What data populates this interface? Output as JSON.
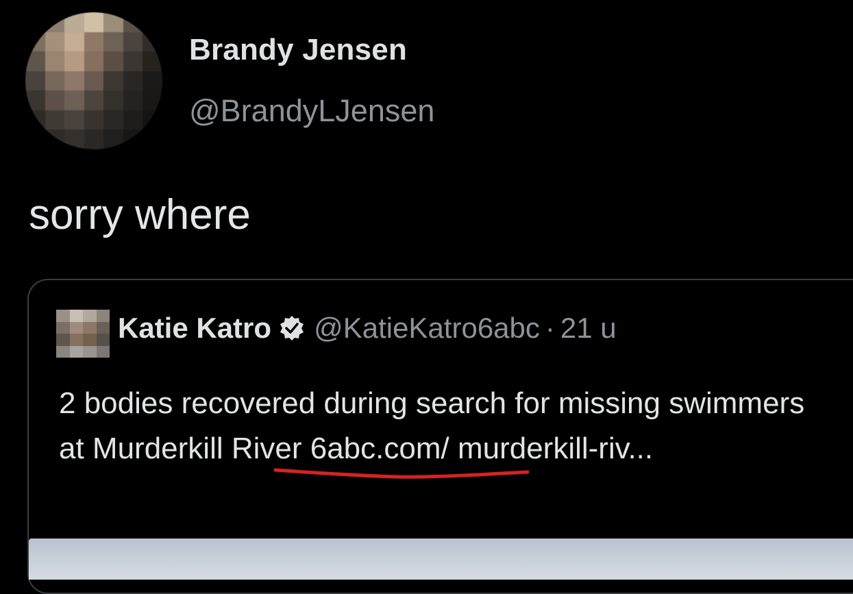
{
  "tweet": {
    "author_name": "Brandy Jensen",
    "author_handle": "@BrandyLJensen",
    "text": "sorry where",
    "avatar_icon": "pixelated-avatar"
  },
  "quoted_tweet": {
    "author_name": "Katie Katro",
    "verified_icon": "verified-badge-icon",
    "author_handle": "@KatieKatro6abc",
    "separator": "·",
    "time": "21 u",
    "body_before": "2 bodies recovered during search for missing swimmers at ",
    "body_highlight": "Murderkill River",
    "body_after": " 6abc.com/ murderkill-riv...",
    "annotation_color": "#d6231f"
  },
  "colors": {
    "background": "#000000",
    "card_border": "#3a3e42",
    "secondary_text": "#8d9399"
  }
}
